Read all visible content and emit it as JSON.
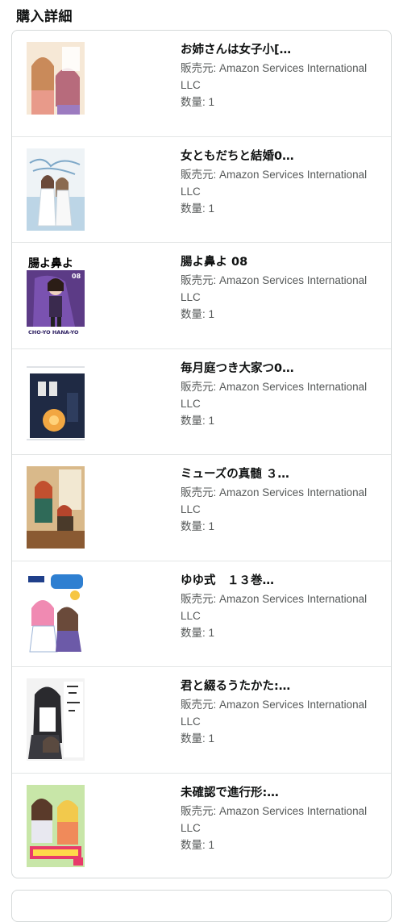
{
  "section": {
    "title": "購入詳細"
  },
  "items": [
    {
      "title": "お姉さんは女子小[…",
      "seller": "販売元: Amazon Services International LLC",
      "qty": "数量: 1"
    },
    {
      "title": "女ともだちと結婚0…",
      "seller": "販売元: Amazon Services International LLC",
      "qty": "数量: 1"
    },
    {
      "title": "腸よ鼻よ 08",
      "seller": "販売元: Amazon Services International LLC",
      "qty": "数量: 1"
    },
    {
      "title": "毎月庭つき大家つ0…",
      "seller": "販売元: Amazon Services International LLC",
      "qty": "数量: 1"
    },
    {
      "title": "ミューズの真髄 ３…",
      "seller": "販売元: Amazon Services International LLC",
      "qty": "数量: 1"
    },
    {
      "title": "ゆゆ式　１３巻…",
      "seller": "販売元: Amazon Services International LLC",
      "qty": "数量: 1"
    },
    {
      "title": "君と綴るうたかた:…",
      "seller": "販売元: Amazon Services International LLC",
      "qty": "数量: 1"
    },
    {
      "title": "未確認で進行形:…",
      "seller": "販売元: Amazon Services International LLC",
      "qty": "数量: 1"
    }
  ],
  "covers": {
    "c3_title": "腸よ鼻よ",
    "c3_num": "08",
    "c3_sub": "CHO-YO HANA-YO"
  }
}
